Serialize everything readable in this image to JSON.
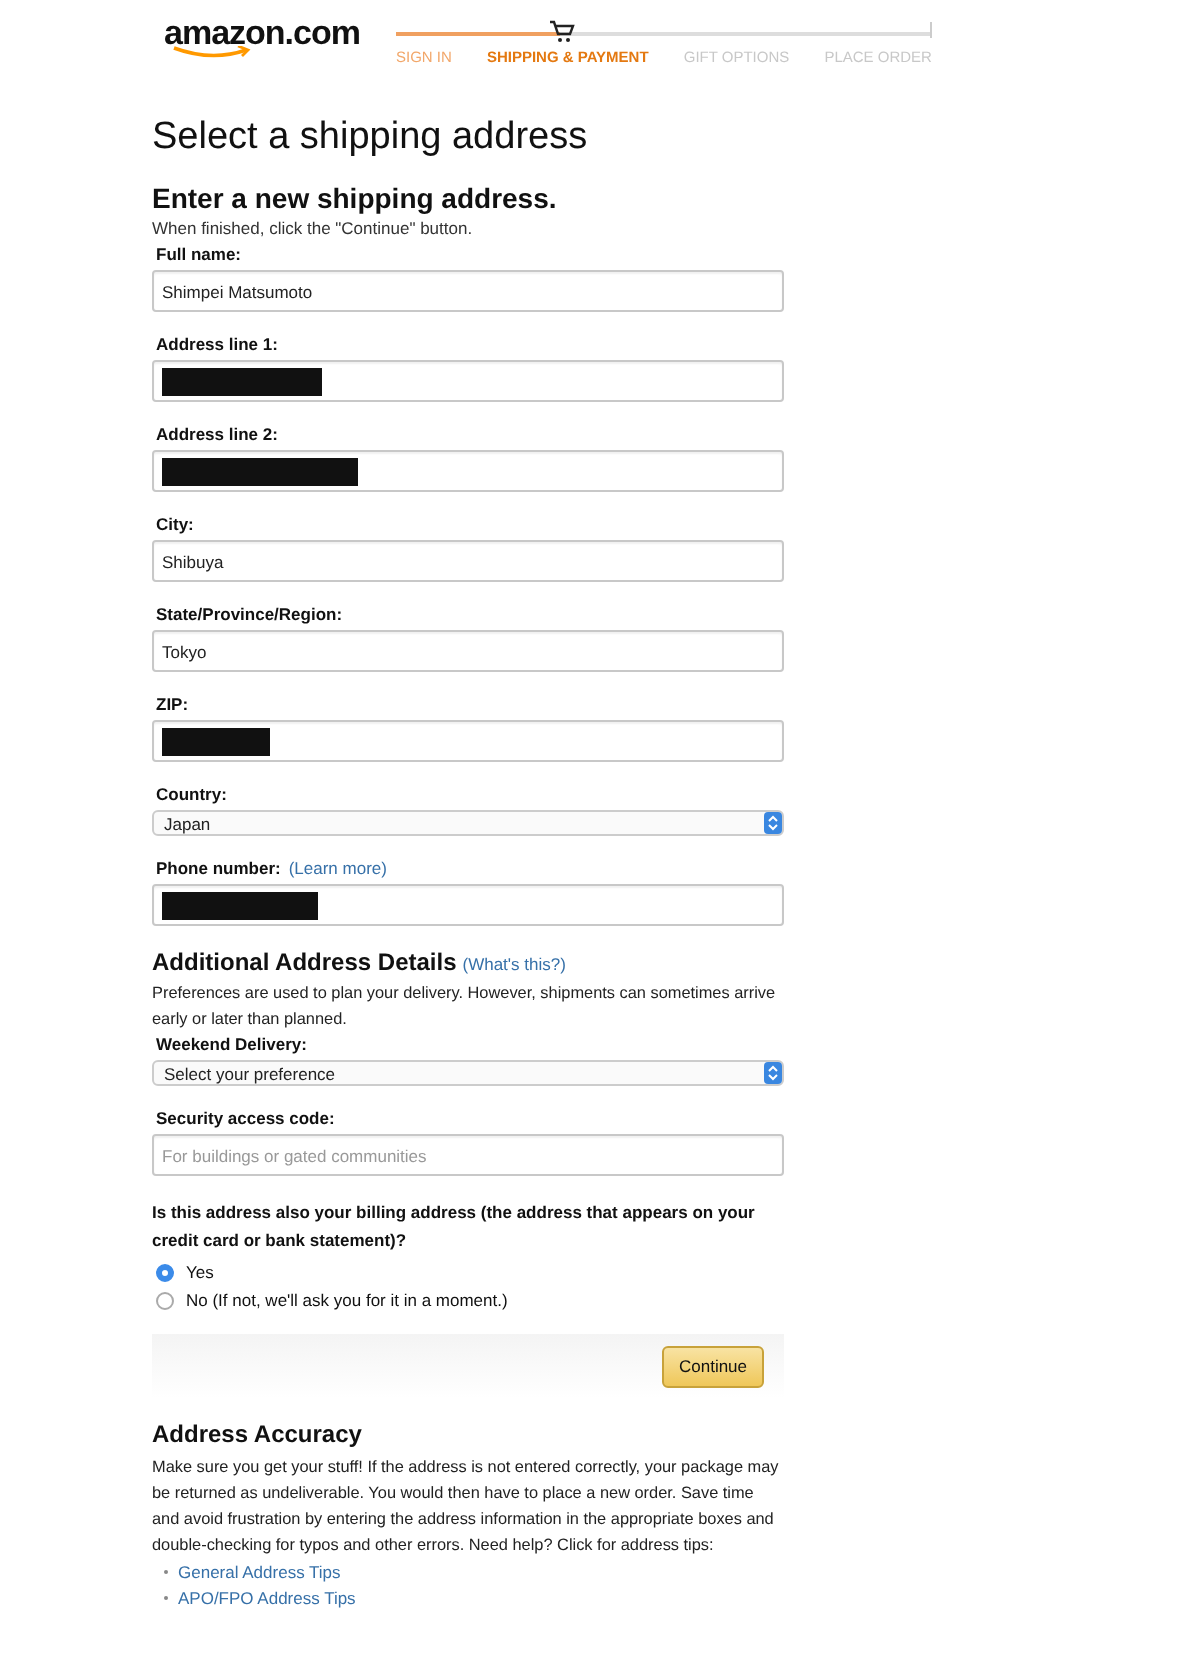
{
  "header": {
    "logo": "amazon.com",
    "steps": [
      {
        "label": "SIGN IN",
        "done": true,
        "selected": false
      },
      {
        "label": "SHIPPING & PAYMENT",
        "done": false,
        "selected": true
      },
      {
        "label": "GIFT OPTIONS",
        "done": false,
        "selected": false
      },
      {
        "label": "PLACE ORDER",
        "done": false,
        "selected": false
      }
    ]
  },
  "page_title": "Select a shipping address",
  "form": {
    "heading": "Enter a new shipping address.",
    "instruction": "When finished, click the \"Continue\" button.",
    "fields": [
      {
        "kind": "text",
        "label": "Full name:",
        "value": "Shimpei Matsumoto"
      },
      {
        "kind": "text",
        "label": "Address line 1:",
        "redacted": true
      },
      {
        "kind": "text",
        "label": "Address line 2:",
        "redacted": true
      },
      {
        "kind": "text",
        "label": "City:",
        "value": "Shibuya"
      },
      {
        "kind": "text",
        "label": "State/Province/Region:",
        "value": "Tokyo"
      },
      {
        "kind": "text",
        "label": "ZIP:",
        "redacted": true
      },
      {
        "kind": "select",
        "label": "Country:",
        "value": "Japan"
      },
      {
        "kind": "text",
        "label": "Phone number:",
        "link": "(Learn more)",
        "redacted": true
      }
    ]
  },
  "additional": {
    "heading": "Additional Address Details",
    "link": "(What's this?)",
    "description": "Preferences are used to plan your delivery. However, shipments can sometimes arrive early or later than planned.",
    "fields": [
      {
        "kind": "select",
        "label": "Weekend Delivery:",
        "value": "Select your preference"
      },
      {
        "kind": "text",
        "label": "Security access code:",
        "placeholder": "For buildings or gated communities"
      }
    ]
  },
  "billing": {
    "question": "Is this address also your billing address (the address that appears on your credit card or bank statement)?",
    "options": [
      {
        "label": "Yes",
        "selected": true
      },
      {
        "label": "No  (If not, we'll ask you for it in a moment.)",
        "selected": false
      }
    ]
  },
  "continue_button": "Continue",
  "accuracy": {
    "heading": "Address Accuracy",
    "text": "Make sure you get your stuff! If the address is not entered correctly, your package may be returned as undeliverable. You would then have to place a new order. Save time and avoid frustration by entering the address information in the appropriate boxes and double-checking for typos and other errors. Need help? Click for address tips:",
    "links": [
      "General Address Tips",
      "APO/FPO Address Tips"
    ]
  }
}
